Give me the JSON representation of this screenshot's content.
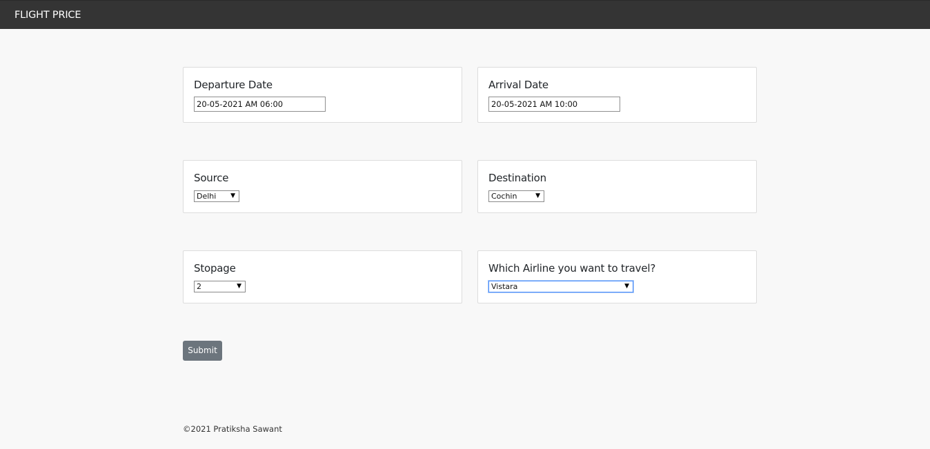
{
  "header": {
    "brand": "FLIGHT PRICE"
  },
  "form": {
    "departure": {
      "label": "Departure Date",
      "value": "20-05-2021 AM 06:00"
    },
    "arrival": {
      "label": "Arrival Date",
      "value": "20-05-2021 AM 10:00"
    },
    "source": {
      "label": "Source",
      "selected": "Delhi"
    },
    "destination": {
      "label": "Destination",
      "selected": "Cochin"
    },
    "stopage": {
      "label": "Stopage",
      "selected": "2"
    },
    "airline": {
      "label": "Which Airline you want to travel?",
      "selected": "Vistara"
    },
    "submit_label": "Submit"
  },
  "footer": {
    "text": "©2021 Pratiksha Sawant"
  },
  "colors": {
    "navbar": "#343434",
    "background": "#f8f8f8",
    "submit": "#6c757d"
  },
  "icons": {
    "dropdown": "triangle-down-icon"
  }
}
